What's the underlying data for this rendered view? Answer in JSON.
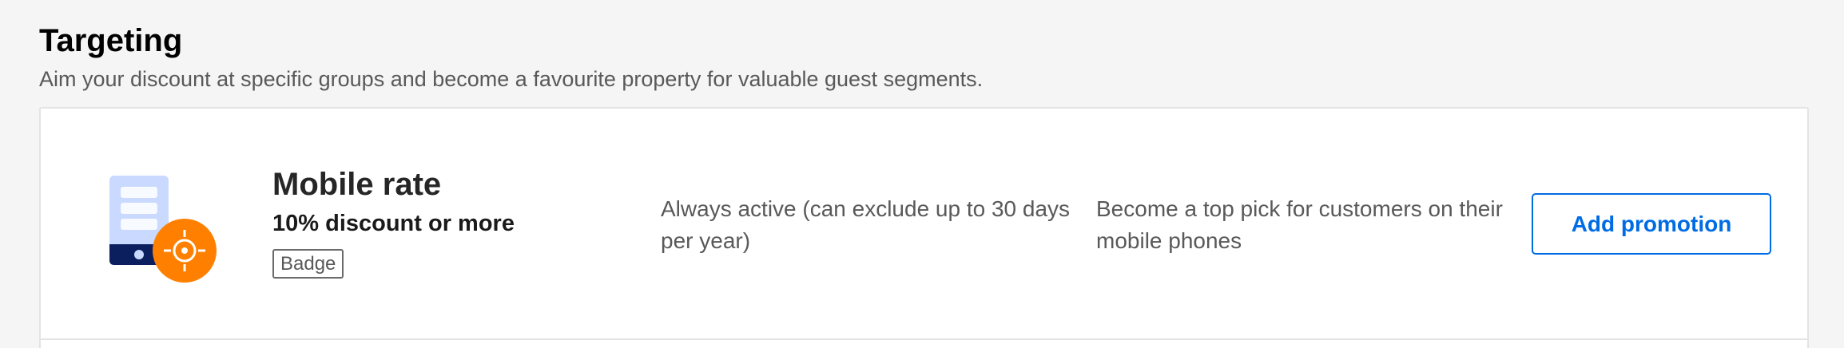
{
  "section": {
    "title": "Targeting",
    "subtitle": "Aim your discount at specific groups and become a favourite property for valuable guest segments."
  },
  "promotion": {
    "icon": "mobile-phone-target-icon",
    "title": "Mobile rate",
    "discount": "10% discount or more",
    "badge": "Badge",
    "availability": "Always active (can exclude up to 30 days per year)",
    "benefit": "Become a top pick for customers on their mobile phones",
    "button_label": "Add promotion"
  },
  "colors": {
    "accent": "#006ce4",
    "icon_orange": "#ff8000",
    "icon_navy": "#0b1f5e",
    "icon_light_blue": "#c9d9ff",
    "page_background": "#f5f5f5"
  }
}
